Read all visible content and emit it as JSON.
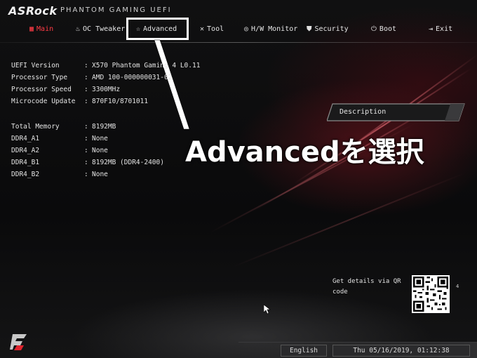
{
  "header": {
    "brand": "ASRock",
    "product": "PHANTOM GAMING UEFI"
  },
  "nav": [
    {
      "label": "Main",
      "icon": "main-icon",
      "active": true
    },
    {
      "label": "OC Tweaker",
      "icon": "flame-icon",
      "active": false
    },
    {
      "label": "Advanced",
      "icon": "star-icon",
      "active": false
    },
    {
      "label": "Tool",
      "icon": "tool-icon",
      "active": false
    },
    {
      "label": "H/W Monitor",
      "icon": "monitor-icon",
      "active": false
    },
    {
      "label": "Security",
      "icon": "shield-icon",
      "active": false
    },
    {
      "label": "Boot",
      "icon": "power-icon",
      "active": false
    },
    {
      "label": "Exit",
      "icon": "exit-icon",
      "active": false
    }
  ],
  "system_info": [
    {
      "key": "UEFI Version",
      "value": "X570 Phantom Gaming 4 L0.11"
    },
    {
      "key": "Processor Type",
      "value": "AMD 100-000000031-02"
    },
    {
      "key": "Processor Speed",
      "value": "3300MHz"
    },
    {
      "key": "Microcode Update",
      "value": "870F10/8701011"
    }
  ],
  "memory_info": [
    {
      "key": "Total Memory",
      "value": "8192MB"
    },
    {
      "key": "DDR4_A1",
      "value": "None"
    },
    {
      "key": "DDR4_A2",
      "value": "None"
    },
    {
      "key": "DDR4_B1",
      "value": "8192MB (DDR4-2400)"
    },
    {
      "key": "DDR4_B2",
      "value": "None"
    }
  ],
  "description": {
    "label": "Description"
  },
  "annotation": {
    "text": "Advancedを選択"
  },
  "qr": {
    "text": "Get details via QR code",
    "page_number": "4"
  },
  "footer": {
    "language": "English",
    "datetime": "Thu 05/16/2019, 01:12:38"
  },
  "colors": {
    "accent": "#ff3b45",
    "background": "#0b0b0c",
    "callout": "#ffffff"
  }
}
